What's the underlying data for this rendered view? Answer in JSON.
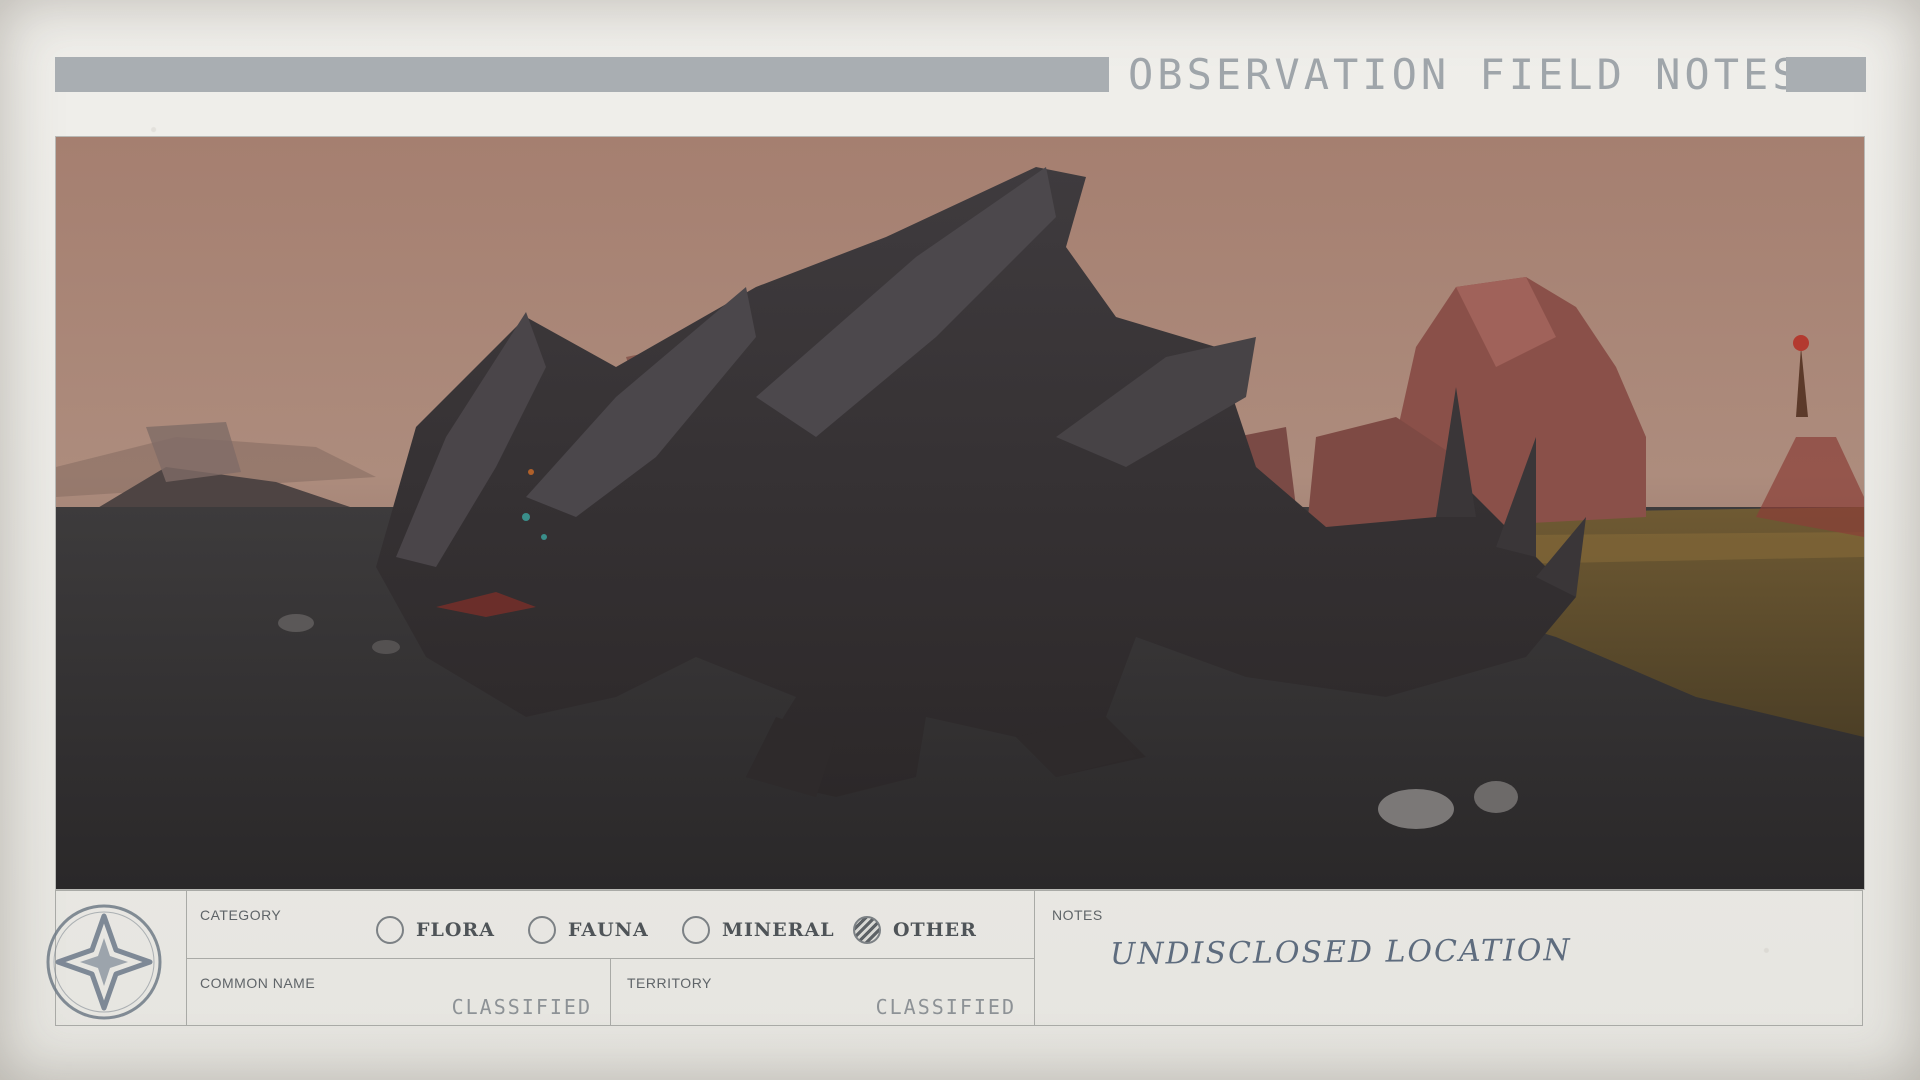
{
  "header": {
    "title": "OBSERVATION FIELD NOTES"
  },
  "photo": {
    "subject": "alien-creature"
  },
  "form": {
    "category": {
      "label": "CATEGORY",
      "options": [
        {
          "label": "FLORA",
          "checked": false
        },
        {
          "label": "FAUNA",
          "checked": false
        },
        {
          "label": "MINERAL",
          "checked": false
        },
        {
          "label": "OTHER",
          "checked": true
        }
      ]
    },
    "common_name": {
      "label": "COMMON NAME",
      "value": "CLASSIFIED"
    },
    "territory": {
      "label": "TERRITORY",
      "value": "CLASSIFIED"
    },
    "notes": {
      "label": "NOTES",
      "value": "UNDISCLOSED LOCATION"
    }
  },
  "colors": {
    "paper": "#ecebe7",
    "header_bar": "#a9aeb2",
    "title": "#9fa5aa",
    "ink": "#5e6c7e",
    "sky": "#a78576"
  },
  "icons": {
    "emblem": "star-emblem-icon"
  }
}
